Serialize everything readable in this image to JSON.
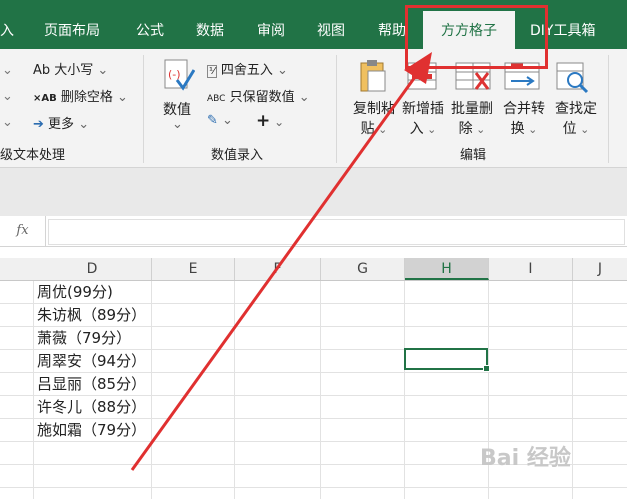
{
  "tabs": [
    "入",
    "页面布局",
    "公式",
    "数据",
    "审阅",
    "视图",
    "帮助",
    "方方格子",
    "DIY工具箱"
  ],
  "ribbon": {
    "text_group": {
      "items": [
        "Ab 大小写",
        "删除空格",
        "更多"
      ],
      "label": "级文本处理"
    },
    "number_group": {
      "value_button": "数值",
      "items": [
        "四舍五入",
        "只保留数值"
      ],
      "label": "数值录入"
    },
    "edit_group": {
      "buttons": [
        {
          "line1": "复制粘",
          "line2": "贴"
        },
        {
          "line1": "新增插",
          "line2": "入"
        },
        {
          "line1": "批量删",
          "line2": "除"
        },
        {
          "line1": "合并转",
          "line2": "换"
        },
        {
          "line1": "查找定",
          "line2": "位"
        }
      ],
      "label": "编辑"
    }
  },
  "formula_bar": {
    "fx": "fx",
    "value": ""
  },
  "columns": [
    "D",
    "E",
    "F",
    "G",
    "H",
    "I",
    "J"
  ],
  "selected_column": "H",
  "cells": [
    "周优(99分)",
    "朱访枫（89分）",
    "萧薇（79分）",
    "周翠安（94分）",
    "吕显丽（85分）",
    "许冬儿（88分）",
    "施如霜（79分）"
  ],
  "watermark": "Bai 经验",
  "colors": {
    "excel_green": "#217346",
    "highlight_red": "#e03030"
  }
}
